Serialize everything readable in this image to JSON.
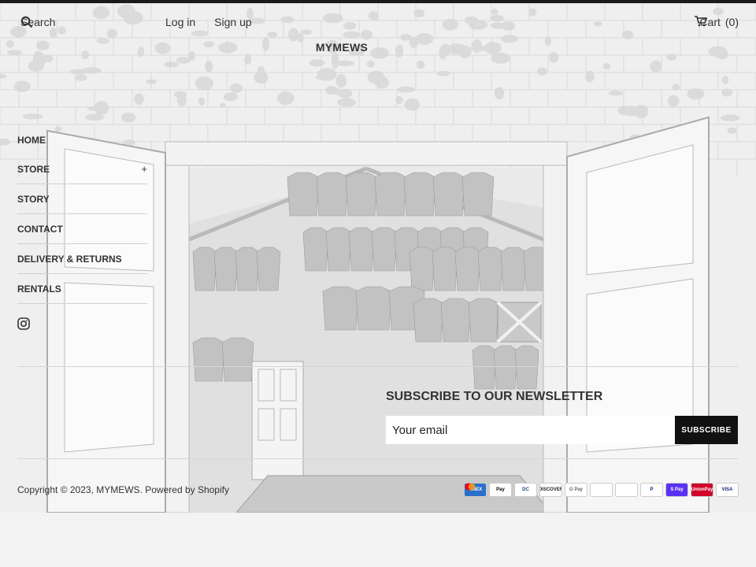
{
  "header": {
    "search_placeholder": "Search",
    "login": "Log in",
    "signup": "Sign up",
    "cart_label": "Cart",
    "cart_count": "(0)",
    "logo": "MYMEWS"
  },
  "nav": {
    "items": [
      {
        "label": "HOME",
        "has_sub": false
      },
      {
        "label": "STORE",
        "has_sub": true,
        "toggle": "+"
      },
      {
        "label": "STORY",
        "has_sub": false
      },
      {
        "label": "CONTACT",
        "has_sub": false
      },
      {
        "label": "DELIVERY & RETURNS",
        "has_sub": false
      },
      {
        "label": "RENTALS",
        "has_sub": false
      }
    ],
    "social_icon": "instagram-icon"
  },
  "newsletter": {
    "title": "SUBSCRIBE TO OUR NEWSLETTER",
    "email_placeholder": "Your email",
    "button": "SUBSCRIBE"
  },
  "footer": {
    "copyright_prefix": "Copyright © 2023, ",
    "brand": "MYMEWS",
    "separator": ". ",
    "powered": "Powered by Shopify"
  },
  "payments": [
    {
      "name": "AMEX",
      "bg": "#2a6fc9",
      "fg": "#ffffff"
    },
    {
      "name": "Pay",
      "bg": "#ffffff",
      "fg": "#000000"
    },
    {
      "name": "DC",
      "bg": "#ffffff",
      "fg": "#1a4a8a"
    },
    {
      "name": "DISCOVER",
      "bg": "#ffffff",
      "fg": "#222222"
    },
    {
      "name": "G Pay",
      "bg": "#ffffff",
      "fg": "#5f6368"
    },
    {
      "name": "",
      "bg": "#ffffff",
      "fg": "#ffffff"
    },
    {
      "name": "",
      "bg": "#ffffff",
      "fg": "#ffffff"
    },
    {
      "name": "P",
      "bg": "#ffffff",
      "fg": "#003087"
    },
    {
      "name": "S Pay",
      "bg": "#5a31f4",
      "fg": "#ffffff"
    },
    {
      "name": "UnionPay",
      "bg": "#d10429",
      "fg": "#ffffff"
    },
    {
      "name": "VISA",
      "bg": "#ffffff",
      "fg": "#1a1f71"
    }
  ],
  "colors": {
    "text": "#333333",
    "button_bg": "#111111",
    "topbar": "#1a1a1a"
  }
}
